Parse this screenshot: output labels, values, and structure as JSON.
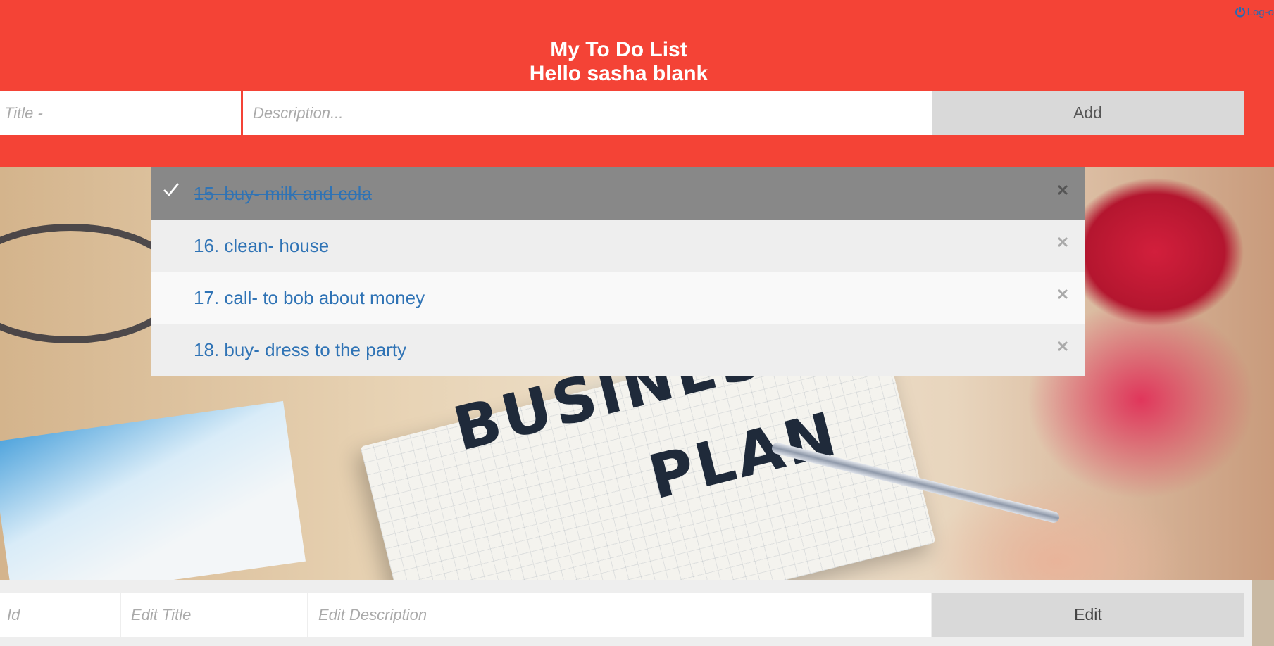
{
  "header": {
    "title": "My To Do List",
    "greeting": "Hello sasha blank",
    "logout_label": "Log-o",
    "accent_color": "#f44336"
  },
  "add_form": {
    "title_placeholder": "Title -",
    "description_placeholder": "Description...",
    "add_label": "Add"
  },
  "todos": [
    {
      "text": "15. buy-   milk and cola",
      "checked": true
    },
    {
      "text": "16. clean-   house",
      "checked": false
    },
    {
      "text": "17. call-   to bob about money",
      "checked": false
    },
    {
      "text": "18. buy-   dress to the party",
      "checked": false
    }
  ],
  "background_image": {
    "notebook_text_1": "BUSINES",
    "notebook_text_2": "PLAN"
  },
  "edit_form": {
    "id_placeholder": "Id",
    "title_placeholder": "Edit Title",
    "description_placeholder": "Edit Description",
    "edit_label": "Edit"
  },
  "icons": {
    "check": "check-icon",
    "close": "close-icon",
    "logout": "power-icon"
  }
}
